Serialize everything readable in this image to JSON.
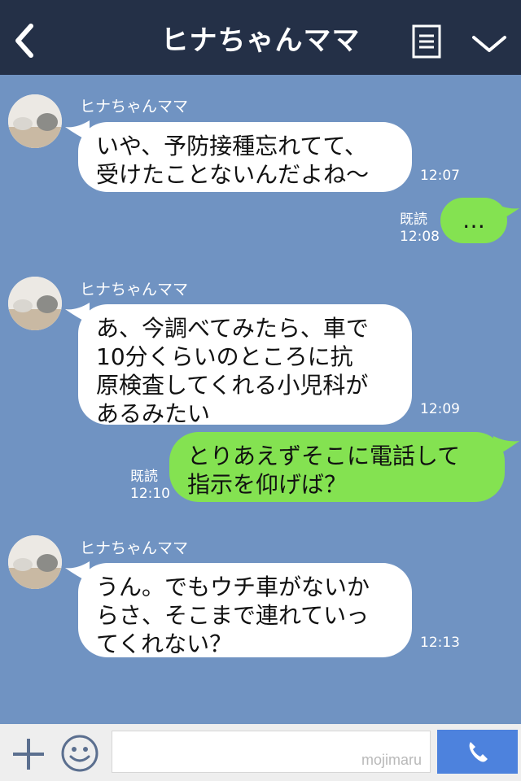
{
  "header": {
    "title": "ヒナちゃんママ"
  },
  "messages": [
    {
      "sender": "ヒナちゃんママ",
      "text": "いや、予防接種忘れてて、\n受けたことないんだよね〜",
      "time": "12:07"
    },
    {
      "text": "…",
      "read": "既読",
      "time": "12:08"
    },
    {
      "sender": "ヒナちゃんママ",
      "text": "あ、今調べてみたら、車で\n10分くらいのところに抗\n原検査してくれる小児科が\nあるみたい",
      "time": "12:09"
    },
    {
      "text": "とりあえずそこに電話して\n指示を仰げば？",
      "read": "既読",
      "time": "12:10"
    },
    {
      "sender": "ヒナちゃんママ",
      "text": "うん。でもウチ車がないか\nらさ、そこまで連れていっ\nてくれない？",
      "time": "12:13"
    }
  ],
  "input": {
    "watermark": "mojimaru"
  },
  "colors": {
    "header": "#243047",
    "background": "#7093c2",
    "outgoing_bubble": "#84e251",
    "incoming_bubble": "#ffffff",
    "call_button": "#4d82dd"
  },
  "icons": {
    "back": "chevron-left-icon",
    "menu": "menu-icon",
    "collapse": "chevron-down-icon",
    "plus": "plus-icon",
    "emoji": "smiley-icon",
    "call": "phone-icon"
  }
}
